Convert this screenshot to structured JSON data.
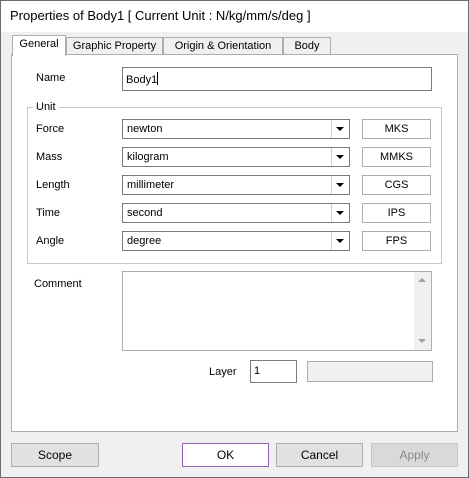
{
  "window": {
    "title": "Properties of Body1 [ Current Unit : N/kg/mm/s/deg ]"
  },
  "tabs": [
    {
      "label": "General",
      "active": true
    },
    {
      "label": "Graphic Property",
      "active": false
    },
    {
      "label": "Origin & Orientation",
      "active": false
    },
    {
      "label": "Body",
      "active": false
    }
  ],
  "general": {
    "name_label": "Name",
    "name_value": "Body1",
    "unit_group_title": "Unit",
    "units": [
      {
        "label": "Force",
        "value": "newton",
        "preset": "MKS"
      },
      {
        "label": "Mass",
        "value": "kilogram",
        "preset": "MMKS"
      },
      {
        "label": "Length",
        "value": "millimeter",
        "preset": "CGS"
      },
      {
        "label": "Time",
        "value": "second",
        "preset": "IPS"
      },
      {
        "label": "Angle",
        "value": "degree",
        "preset": "FPS"
      }
    ],
    "comment_label": "Comment",
    "comment_value": "",
    "layer_label": "Layer",
    "layer_value": "1"
  },
  "footer": {
    "scope_label": "Scope",
    "ok_label": "OK",
    "cancel_label": "Cancel",
    "apply_label": "Apply"
  },
  "colors": {
    "default_button_border": "#9463b7",
    "window_background": "#f0f0f0"
  }
}
